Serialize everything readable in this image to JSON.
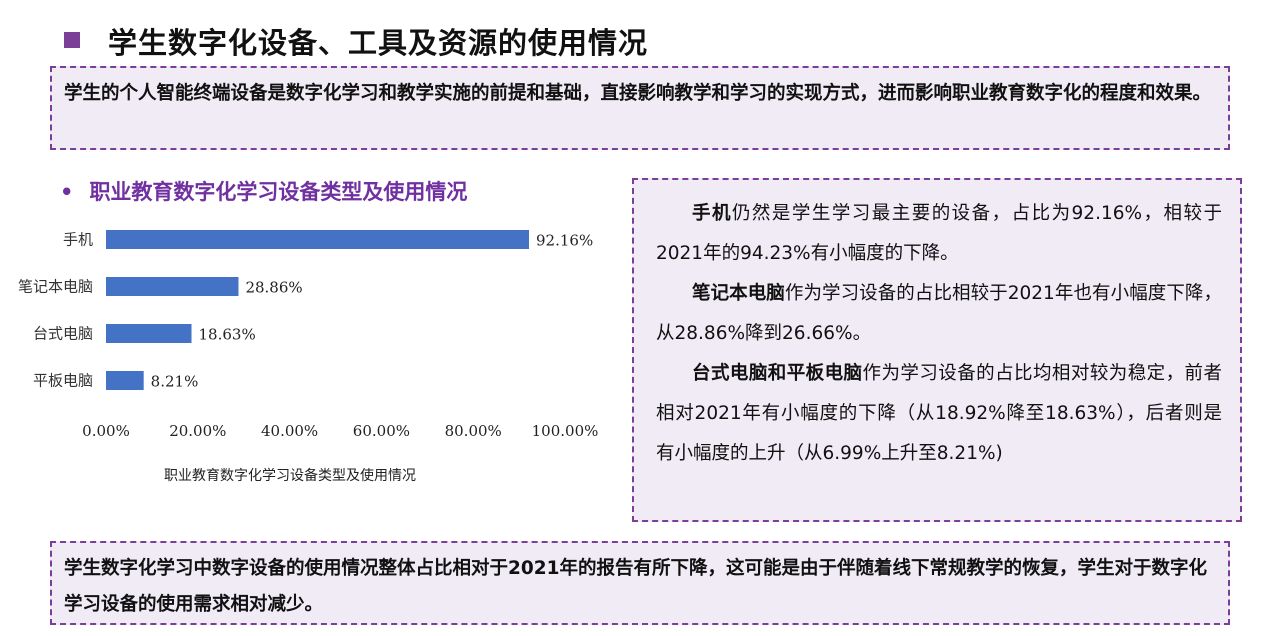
{
  "title": "学生数字化设备、工具及资源的使用情况",
  "intro": "学生的个人智能终端设备是数字化学习和教学实施的前提和基础，直接影响教学和学习的实现方式，进而影响职业教育数字化的程度和效果。",
  "section_heading": "职业教育数字化学习设备类型及使用情况",
  "chart_caption": "职业教育数字化学习设备类型及使用情况",
  "right_panel": {
    "p1_bold": "手机",
    "p1_rest": "仍然是学生学习最主要的设备，占比为92.16%，相较于2021年的94.23%有小幅度的下降。",
    "p2_bold": "笔记本电脑",
    "p2_rest": "作为学习设备的占比相较于2021年也有小幅度下降，从28.86%降到26.66%。",
    "p3_bold": "台式电脑和平板电脑",
    "p3_rest": "作为学习设备的占比均相对较为稳定，前者相对2021年有小幅度的下降（从18.92%降至18.63%），后者则是有小幅度的上升（从6.99%上升至8.21%)"
  },
  "conclusion": "学生数字化学习中数字设备的使用情况整体占比相对于2021年的报告有所下降，这可能是由于伴随着线下常规教学的恢复，学生对于数字化学习设备的使用需求相对减少。",
  "colors": {
    "accent": "#7b3f98",
    "heading": "#7030a0",
    "bar": "#4472c4",
    "box_bg": "#f0ebf5"
  },
  "chart_data": {
    "type": "bar",
    "orientation": "horizontal",
    "categories": [
      "手机",
      "笔记本电脑",
      "台式电脑",
      "平板电脑"
    ],
    "values": [
      92.16,
      28.86,
      18.63,
      8.21
    ],
    "value_labels": [
      "92.16%",
      "28.86%",
      "18.63%",
      "8.21%"
    ],
    "xlim": [
      0,
      100
    ],
    "x_ticks": [
      "0.00%",
      "20.00%",
      "40.00%",
      "60.00%",
      "80.00%",
      "100.00%"
    ],
    "grid": false,
    "legend": "none"
  }
}
